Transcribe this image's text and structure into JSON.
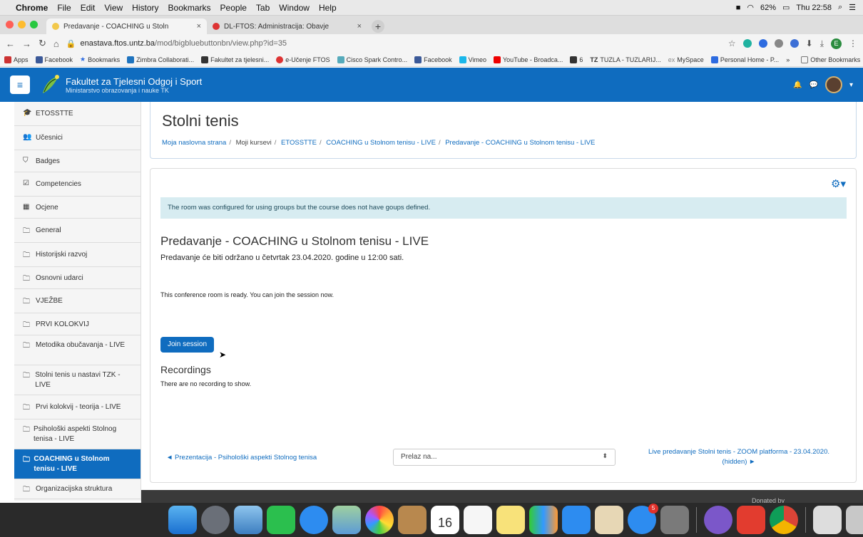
{
  "menubar": {
    "app": "Chrome",
    "items": [
      "File",
      "Edit",
      "View",
      "History",
      "Bookmarks",
      "People",
      "Tab",
      "Window",
      "Help"
    ],
    "battery": "62%",
    "clock": "Thu 22:58"
  },
  "tabs": [
    {
      "title": "Predavanje - COACHING u Stoln",
      "close": "×"
    },
    {
      "title": "DL-FTOS: Administracija: Obavje",
      "close": "×"
    }
  ],
  "newtab": "+",
  "address": {
    "host": "enastava.ftos.untz.ba",
    "path": "/mod/bigbluebuttonbn/view.php?id=35"
  },
  "profile_initial": "E",
  "bookmarks": [
    "Apps",
    "Facebook",
    "Bookmarks",
    "Zimbra Collaborati...",
    "Fakultet za tjelesni...",
    "e-Učenje FTOS",
    "Cisco Spark Contro...",
    "Facebook",
    "Vimeo",
    "YouTube - Broadca...",
    "6",
    "TUZLA - TUZLARIJ...",
    "MySpace",
    "Personal Home - P...",
    "»"
  ],
  "other_bookmarks": "Other Bookmarks",
  "site": {
    "name": "Fakultet za Tjelesni Odgoj i Sport",
    "subtitle": "Ministarstvo obrazovanja i nauke TK"
  },
  "sidebar": [
    {
      "icon": "🎓",
      "label": "ETOSSTTE"
    },
    {
      "icon": "👥",
      "label": "Učesnici"
    },
    {
      "icon": "⛉",
      "label": "Badges"
    },
    {
      "icon": "☑",
      "label": "Competencies"
    },
    {
      "icon": "▦",
      "label": "Ocjene"
    },
    {
      "icon": "🗀",
      "label": "General"
    },
    {
      "icon": "🗀",
      "label": "Historijski razvoj"
    },
    {
      "icon": "🗀",
      "label": "Osnovni udarci"
    },
    {
      "icon": "🗀",
      "label": "VJEŽBE"
    },
    {
      "icon": "🗀",
      "label": "PRVI KOLOKVIJ"
    },
    {
      "icon": "🗀",
      "label": "Metodika obučavanja - LIVE"
    },
    {
      "icon": "🗀",
      "label": "Stolni tenis u nastavi TZK - LIVE"
    },
    {
      "icon": "🗀",
      "label": "Prvi kolokvij - teorija - LIVE"
    },
    {
      "icon": "🗀",
      "label": "Psihološki aspekti Stolnog tenisa - LIVE"
    },
    {
      "icon": "🗀",
      "label": "COACHING u Stolnom tenisu - LIVE"
    },
    {
      "icon": "🗀",
      "label": "Organizacijska struktura"
    }
  ],
  "page": {
    "title": "Stolni tenis",
    "breadcrumb": [
      "Moja naslovna strana",
      "Moji kursevi",
      "ETOSSTTE",
      "COACHING u Stolnom tenisu - LIVE",
      "Predavanje - COACHING u Stolnom tenisu - LIVE"
    ],
    "alert": "The room was configured for using groups but the course does not have goups defined.",
    "activity_title": "Predavanje - COACHING u Stolnom tenisu - LIVE",
    "activity_desc": "Predavanje će biti održano u četvrtak 23.04.2020. godine u 12:00 sati.",
    "ready": "This conference room is ready. You can join the session now.",
    "join": "Join session",
    "recordings_title": "Recordings",
    "recordings_none": "There are no recording to show.",
    "prev": "◄ Prezentacija - Psihološki aspekti Stolnog tenisa",
    "jump": "Prelaz na...",
    "next": "Live predavanje Stolni tenis - ZOOM platforma - 23.04.2020. (hidden) ►",
    "footer": "Donated by"
  },
  "dock": {
    "calendar_day": "16",
    "appstore_badge": "5"
  }
}
